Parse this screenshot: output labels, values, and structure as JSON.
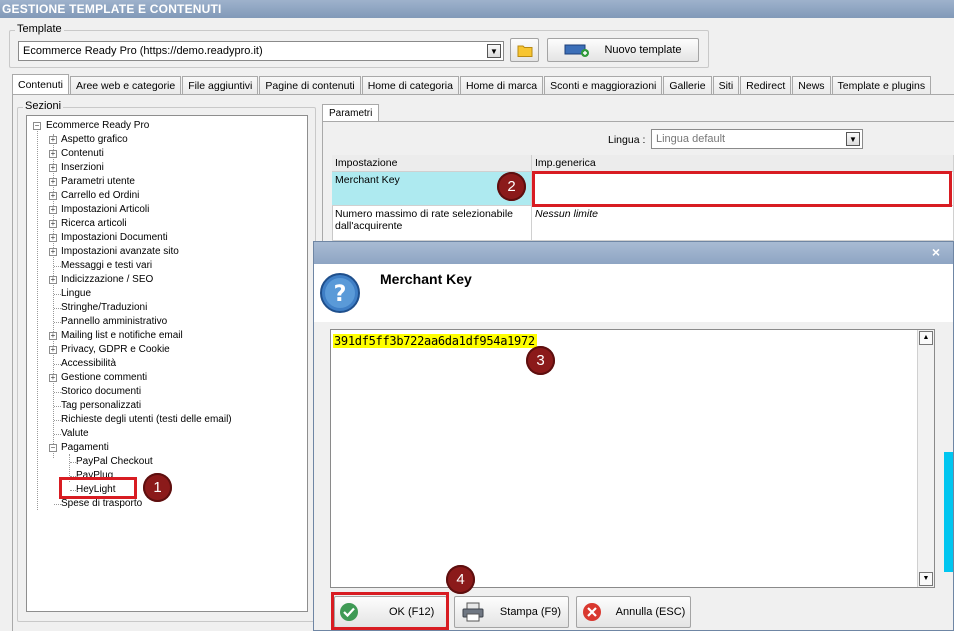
{
  "window": {
    "title": "GESTIONE TEMPLATE E CONTENUTI"
  },
  "template_group": {
    "legend": "Template",
    "selected": "Ecommerce Ready Pro (https://demo.readypro.it)",
    "new_button": "Nuovo template"
  },
  "tabs": [
    "Contenuti",
    "Aree web e categorie",
    "File aggiuntivi",
    "Pagine di contenuti",
    "Home di categoria",
    "Home di marca",
    "Sconti e maggiorazioni",
    "Gallerie",
    "Siti",
    "Redirect",
    "News",
    "Template e plugins"
  ],
  "sezioni": {
    "legend": "Sezioni",
    "root": "Ecommerce Ready Pro",
    "items": [
      {
        "label": "Aspetto grafico",
        "expandable": true
      },
      {
        "label": "Contenuti",
        "expandable": true
      },
      {
        "label": "Inserzioni",
        "expandable": true
      },
      {
        "label": "Parametri utente",
        "expandable": true
      },
      {
        "label": "Carrello ed Ordini",
        "expandable": true
      },
      {
        "label": "Impostazioni Articoli",
        "expandable": true
      },
      {
        "label": "Ricerca articoli",
        "expandable": true
      },
      {
        "label": "Impostazioni Documenti",
        "expandable": true
      },
      {
        "label": "Impostazioni avanzate sito",
        "expandable": true
      },
      {
        "label": "Messaggi e testi vari",
        "expandable": false
      },
      {
        "label": "Indicizzazione / SEO",
        "expandable": true
      },
      {
        "label": "Lingue",
        "expandable": false
      },
      {
        "label": "Stringhe/Traduzioni",
        "expandable": false
      },
      {
        "label": "Pannello amministrativo",
        "expandable": false
      },
      {
        "label": "Mailing list e notifiche email",
        "expandable": true
      },
      {
        "label": "Privacy, GDPR e Cookie",
        "expandable": true
      },
      {
        "label": "Accessibilità",
        "expandable": false
      },
      {
        "label": "Gestione commenti",
        "expandable": true
      },
      {
        "label": "Storico documenti",
        "expandable": false
      },
      {
        "label": "Tag personalizzati",
        "expandable": false
      },
      {
        "label": "Richieste degli utenti (testi delle email)",
        "expandable": false
      },
      {
        "label": "Valute",
        "expandable": false
      },
      {
        "label": "Pagamenti",
        "expandable": true,
        "expanded": true
      }
    ],
    "payments_children": [
      "PayPal Checkout",
      "PayPlug",
      "HeyLight"
    ],
    "last_item": "Spese di trasporto"
  },
  "parametri": {
    "tab": "Parametri",
    "lingua_label": "Lingua :",
    "lingua_value": "Lingua default",
    "col_setting": "Impostazione",
    "col_value": "Imp.generica",
    "rows": [
      {
        "setting": "Merchant Key",
        "value": ""
      },
      {
        "setting": "Numero massimo di rate selezionabile dall'acquirente",
        "value": "Nessun limite"
      }
    ]
  },
  "dialog": {
    "close": "×",
    "title": "Merchant Key",
    "value": "391df5ff3b722aa6da1df954a1972",
    "buttons": {
      "ok": "OK (F12)",
      "print": "Stampa (F9)",
      "cancel": "Annulla (ESC)"
    }
  },
  "callouts": [
    "1",
    "2",
    "3",
    "4"
  ]
}
